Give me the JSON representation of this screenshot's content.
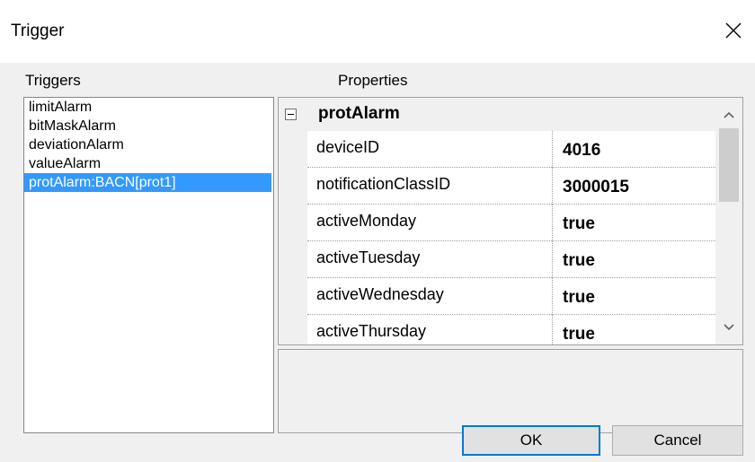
{
  "window": {
    "title": "Trigger"
  },
  "labels": {
    "triggers": "Triggers",
    "properties": "Properties"
  },
  "triggers": [
    {
      "label": "limitAlarm"
    },
    {
      "label": "bitMaskAlarm"
    },
    {
      "label": "deviationAlarm"
    },
    {
      "label": "valueAlarm"
    },
    {
      "label": "protAlarm:BACN[prot1]",
      "selected": true
    }
  ],
  "properties": {
    "category": "protAlarm",
    "rows": [
      {
        "name": "deviceID",
        "value": "4016"
      },
      {
        "name": "notificationClassID",
        "value": "3000015"
      },
      {
        "name": "activeMonday",
        "value": "true"
      },
      {
        "name": "activeTuesday",
        "value": "true"
      },
      {
        "name": "activeWednesday",
        "value": "true"
      },
      {
        "name": "activeThursday",
        "value": "true"
      }
    ]
  },
  "buttons": {
    "ok": "OK",
    "cancel": "Cancel"
  },
  "colors": {
    "selection": "#3399ff",
    "default_button_border": "#0078d7"
  },
  "icons": {
    "close": "close-icon",
    "expander": "minus-box-icon",
    "scroll_up": "chevron-up-icon",
    "scroll_down": "chevron-down-icon"
  }
}
